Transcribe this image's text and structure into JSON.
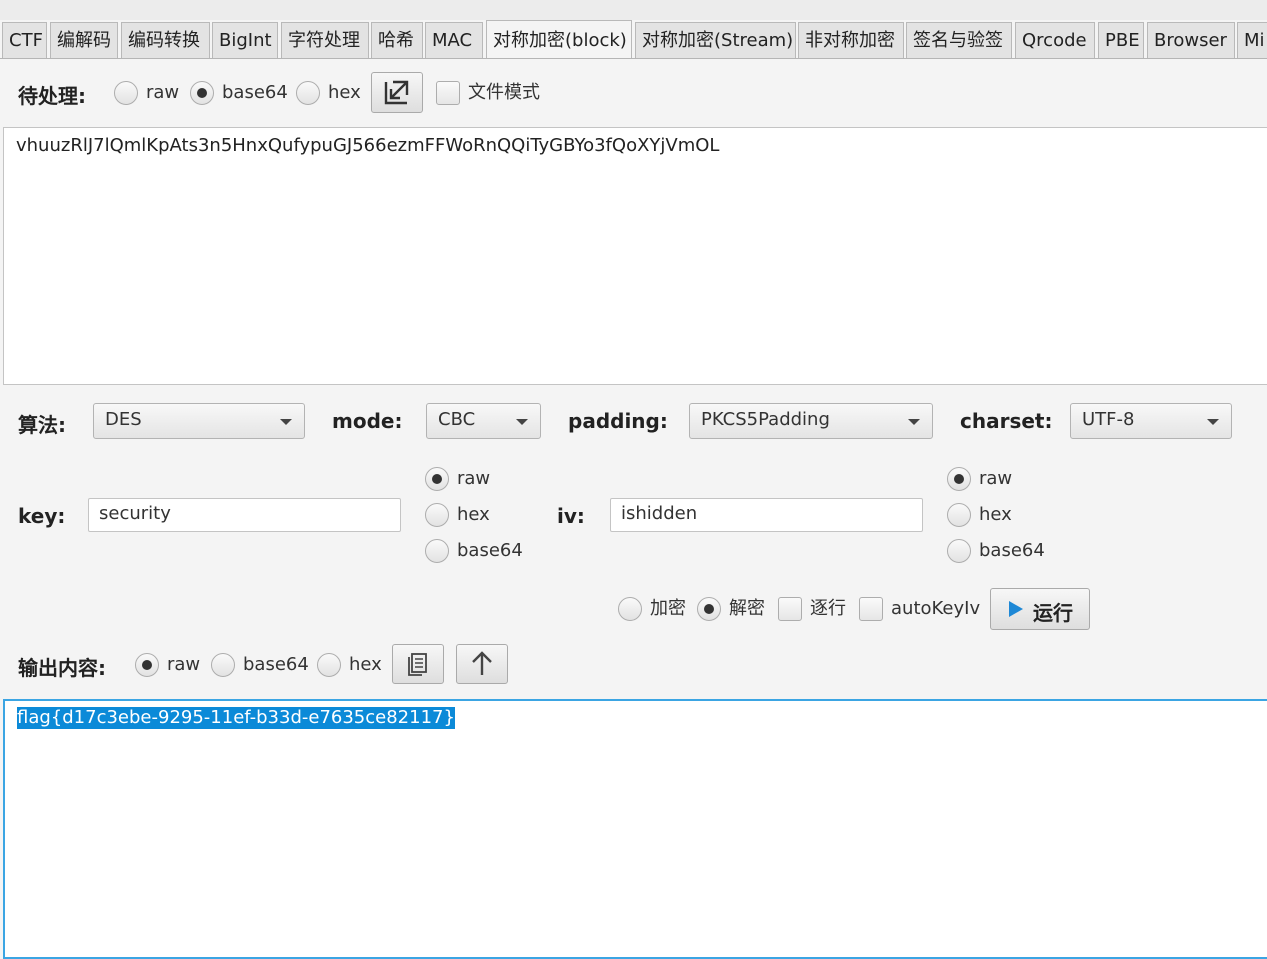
{
  "tabs": [
    "CTF",
    "编解码",
    "编码转换",
    "BigInt",
    "字符处理",
    "哈希",
    "MAC",
    "对称加密(block)",
    "对称加密(Stream)",
    "非对称加密",
    "签名与验签",
    "Qrcode",
    "PBE",
    "Browser",
    "Mi"
  ],
  "active_tab_index": 7,
  "input_section": {
    "label": "待处理:",
    "format_options": [
      "raw",
      "base64",
      "hex"
    ],
    "selected_format": "base64",
    "file_mode_label": "文件模式",
    "file_mode_checked": false,
    "content": "vhuuzRlJ7lQmlKpAts3n5HnxQufypuGJ566ezmFFWoRnQQiTyGBYo3fQoXYjVmOL"
  },
  "settings": {
    "algorithm_label": "算法:",
    "algorithm": "DES",
    "mode_label": "mode:",
    "mode": "CBC",
    "padding_label": "padding:",
    "padding": "PKCS5Padding",
    "charset_label": "charset:",
    "charset": "UTF-8"
  },
  "key": {
    "label": "key:",
    "value": "security",
    "options": [
      "raw",
      "hex",
      "base64"
    ],
    "selected": "raw"
  },
  "iv": {
    "label": "iv:",
    "value": "ishidden",
    "options": [
      "raw",
      "hex",
      "base64"
    ],
    "selected": "raw"
  },
  "actions": {
    "encrypt_label": "加密",
    "decrypt_label": "解密",
    "selected": "decrypt",
    "per_line_label": "逐行",
    "per_line_checked": false,
    "auto_keyiv_label": "autoKeyIv",
    "auto_keyiv_checked": false,
    "run_label": "运行"
  },
  "output_section": {
    "label": "输出内容:",
    "format_options": [
      "raw",
      "base64",
      "hex"
    ],
    "selected_format": "raw",
    "content": "flag{d17c3ebe-9295-11ef-b33d-e7635ce82117}"
  },
  "colors": {
    "accent": "#0b8ad8",
    "focus_border": "#3ba5e3",
    "run_icon": "#1e88d6"
  },
  "icons": {
    "import": "import-arrow-icon",
    "copy": "copy-icon",
    "up": "up-arrow-icon",
    "run": "play-icon"
  }
}
